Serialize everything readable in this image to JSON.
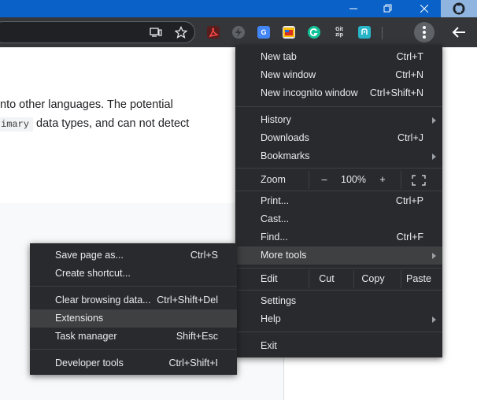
{
  "page": {
    "line1": "nto other languages. The potential",
    "line2_code": "imary",
    "line2_text": " data types, and can not detect"
  },
  "main_menu": {
    "new_tab": {
      "label": "New tab",
      "shortcut": "Ctrl+T"
    },
    "new_window": {
      "label": "New window",
      "shortcut": "Ctrl+N"
    },
    "new_incognito": {
      "label": "New incognito window",
      "shortcut": "Ctrl+Shift+N"
    },
    "history": {
      "label": "History"
    },
    "downloads": {
      "label": "Downloads",
      "shortcut": "Ctrl+J"
    },
    "bookmarks": {
      "label": "Bookmarks"
    },
    "zoom": {
      "label": "Zoom",
      "minus": "–",
      "value": "100%",
      "plus": "+"
    },
    "print": {
      "label": "Print...",
      "shortcut": "Ctrl+P"
    },
    "cast": {
      "label": "Cast..."
    },
    "find": {
      "label": "Find...",
      "shortcut": "Ctrl+F"
    },
    "more_tools": {
      "label": "More tools"
    },
    "edit": {
      "label": "Edit",
      "cut": "Cut",
      "copy": "Copy",
      "paste": "Paste"
    },
    "settings": {
      "label": "Settings"
    },
    "help": {
      "label": "Help"
    },
    "exit": {
      "label": "Exit"
    }
  },
  "sub_menu": {
    "save_page": {
      "label": "Save page as...",
      "shortcut": "Ctrl+S"
    },
    "create_shortcut": {
      "label": "Create shortcut..."
    },
    "clear_browsing": {
      "label": "Clear browsing data...",
      "shortcut": "Ctrl+Shift+Del"
    },
    "extensions": {
      "label": "Extensions"
    },
    "task_manager": {
      "label": "Task manager",
      "shortcut": "Shift+Esc"
    },
    "developer_tools": {
      "label": "Developer tools",
      "shortcut": "Ctrl+Shift+I"
    }
  },
  "extensions_bar": {
    "zip_badge": "Git\nzip"
  },
  "colors": {
    "titlebar": "#0a62c8",
    "toolbar": "#35363a",
    "menu_bg": "#292a2d",
    "menu_highlight": "#3f4042"
  },
  "icons": [
    "github-icon",
    "minimize-icon",
    "maximize-icon",
    "close-icon",
    "install-app-icon",
    "bookmark-star-icon",
    "pdf-icon",
    "bolt-icon",
    "translate-icon",
    "image-icon",
    "grammarly-icon",
    "zip-icon",
    "extension-icon",
    "kebab-menu-icon",
    "back-arrow-icon",
    "fullscreen-icon",
    "submenu-arrow-icon"
  ]
}
